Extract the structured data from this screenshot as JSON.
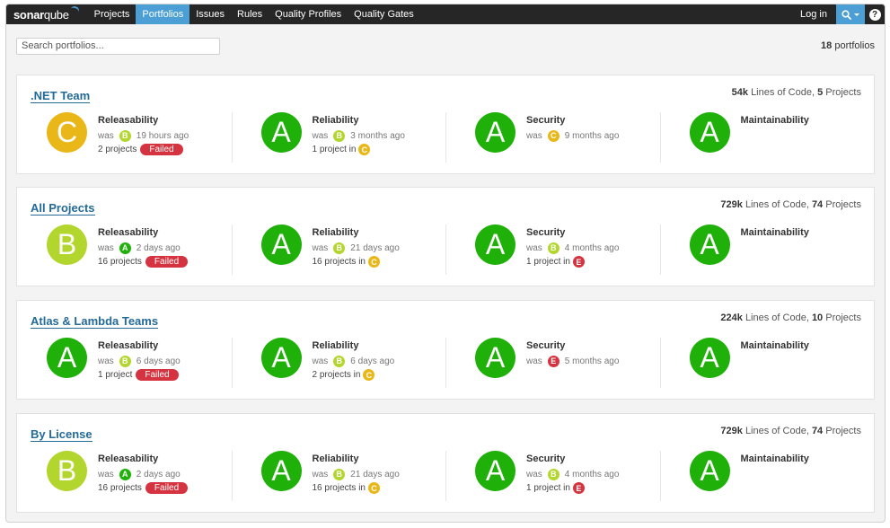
{
  "navbar": {
    "logo_bold": "sonar",
    "logo_light": "qube",
    "items": [
      {
        "label": "Projects",
        "active": false
      },
      {
        "label": "Portfolios",
        "active": true
      },
      {
        "label": "Issues",
        "active": false
      },
      {
        "label": "Rules",
        "active": false
      },
      {
        "label": "Quality Profiles",
        "active": false
      },
      {
        "label": "Quality Gates",
        "active": false
      }
    ],
    "login_label": "Log in",
    "search_icon": "search-icon",
    "help_label": "?"
  },
  "toolbar": {
    "search_placeholder": "Search portfolios...",
    "count_value": "18",
    "count_label": "portfolios"
  },
  "colors": {
    "A": "#1fb009",
    "B": "#b3d62f",
    "C": "#e9b717",
    "E": "#d4333f",
    "accent": "#4b9fd5",
    "failed": "#d4333f"
  },
  "portfolios": [
    {
      "name": ".NET Team",
      "loc": "54k",
      "loc_label": "Lines of Code,",
      "projects": "5",
      "projects_label": "Projects",
      "measures": [
        {
          "title": "Releasability",
          "rating": "C",
          "was_label": "was",
          "was_rating": "B",
          "time": "19 hours ago",
          "detail": "2 projects",
          "status": "Failed"
        },
        {
          "title": "Reliability",
          "rating": "A",
          "was_label": "was",
          "was_rating": "B",
          "time": "3 months ago",
          "detail": "1 project in",
          "detail_rating": "C"
        },
        {
          "title": "Security",
          "rating": "A",
          "was_label": "was",
          "was_rating": "C",
          "time": "9 months ago"
        },
        {
          "title": "Maintainability",
          "rating": "A"
        }
      ]
    },
    {
      "name": "All Projects",
      "loc": "729k",
      "loc_label": "Lines of Code,",
      "projects": "74",
      "projects_label": "Projects",
      "measures": [
        {
          "title": "Releasability",
          "rating": "B",
          "was_label": "was",
          "was_rating": "A",
          "time": "2 days ago",
          "detail": "16 projects",
          "status": "Failed"
        },
        {
          "title": "Reliability",
          "rating": "A",
          "was_label": "was",
          "was_rating": "B",
          "time": "21 days ago",
          "detail": "16 projects in",
          "detail_rating": "C"
        },
        {
          "title": "Security",
          "rating": "A",
          "was_label": "was",
          "was_rating": "B",
          "time": "4 months ago",
          "detail": "1 project in",
          "detail_rating": "E"
        },
        {
          "title": "Maintainability",
          "rating": "A"
        }
      ]
    },
    {
      "name": "Atlas & Lambda Teams",
      "loc": "224k",
      "loc_label": "Lines of Code,",
      "projects": "10",
      "projects_label": "Projects",
      "measures": [
        {
          "title": "Releasability",
          "rating": "A",
          "was_label": "was",
          "was_rating": "B",
          "time": "6 days ago",
          "detail": "1 project",
          "status": "Failed"
        },
        {
          "title": "Reliability",
          "rating": "A",
          "was_label": "was",
          "was_rating": "B",
          "time": "6 days ago",
          "detail": "2 projects in",
          "detail_rating": "C"
        },
        {
          "title": "Security",
          "rating": "A",
          "was_label": "was",
          "was_rating": "E",
          "time": "5 months ago"
        },
        {
          "title": "Maintainability",
          "rating": "A"
        }
      ]
    },
    {
      "name": "By License",
      "loc": "729k",
      "loc_label": "Lines of Code,",
      "projects": "74",
      "projects_label": "Projects",
      "measures": [
        {
          "title": "Releasability",
          "rating": "B",
          "was_label": "was",
          "was_rating": "A",
          "time": "2 days ago",
          "detail": "16 projects",
          "status": "Failed"
        },
        {
          "title": "Reliability",
          "rating": "A",
          "was_label": "was",
          "was_rating": "B",
          "time": "21 days ago",
          "detail": "16 projects in",
          "detail_rating": "C"
        },
        {
          "title": "Security",
          "rating": "A",
          "was_label": "was",
          "was_rating": "B",
          "time": "4 months ago",
          "detail": "1 project in",
          "detail_rating": "E"
        },
        {
          "title": "Maintainability",
          "rating": "A"
        }
      ]
    }
  ]
}
